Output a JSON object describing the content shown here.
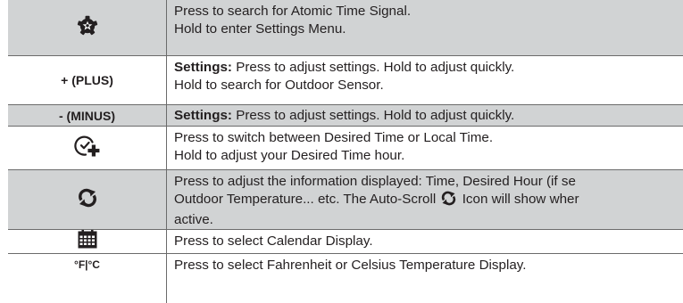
{
  "rows": [
    {
      "key": "",
      "icon": "gear-star-icon",
      "lines": [
        "Press to search for Atomic Time Signal.",
        "Hold to enter Settings Menu."
      ]
    },
    {
      "key": "+ (PLUS)",
      "icon": "",
      "lines": [
        "Press to adjust settings. Hold to adjust quickly.",
        "Hold to search for Outdoor Sensor."
      ],
      "bold_prefix": "Settings:"
    },
    {
      "key": "- (MINUS)",
      "icon": "",
      "lines": [
        "Press to adjust settings. Hold to adjust quickly."
      ],
      "bold_prefix": "Settings:"
    },
    {
      "key": "",
      "icon": "clock-plus-icon",
      "lines": [
        "Press to switch between Desired Time or Local Time.",
        "Hold to adjust your Desired Time hour."
      ]
    },
    {
      "key": "",
      "icon": "auto-scroll-icon",
      "lines": [
        "Press to adjust the information displayed: Time, Desired Hour (if se",
        "Outdoor Temperature... etc. The Auto-Scroll",
        "Icon will show wher",
        "active."
      ]
    },
    {
      "key": "",
      "icon": "calendar-icon",
      "lines": [
        "Press to select Calendar Display."
      ]
    },
    {
      "key": "°F|°C",
      "icon": "",
      "lines": [
        "Press to select Fahrenheit or Celsius Temperature Display."
      ]
    }
  ],
  "colors": {
    "shade": "#d1d3d4",
    "rule": "#6b6b6b",
    "text": "#231f20"
  }
}
